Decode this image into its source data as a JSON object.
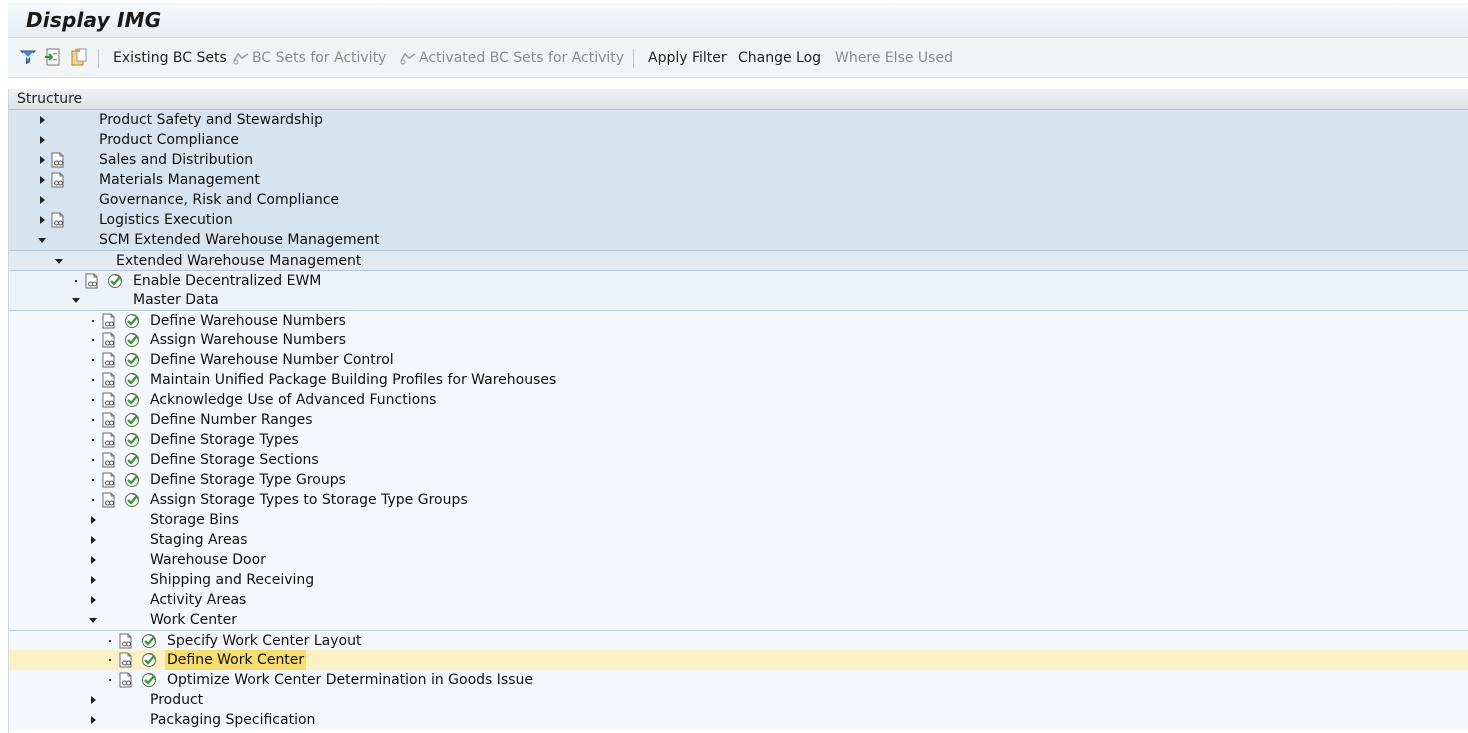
{
  "title": "Display IMG",
  "toolbar": {
    "icons": [
      "filter-icon",
      "export-icon",
      "clipboard-icon"
    ],
    "buttons": [
      {
        "label": "Existing BC Sets",
        "enabled": true
      },
      {
        "label": "BC Sets for Activity",
        "enabled": false
      },
      {
        "label": "Activated BC Sets for Activity",
        "enabled": false
      },
      {
        "label": "Apply Filter",
        "enabled": true
      },
      {
        "label": "Change Log",
        "enabled": true
      },
      {
        "label": "Where Else Used",
        "enabled": false
      }
    ]
  },
  "tree": {
    "header": "Structure",
    "rows": [
      {
        "label": "Product Safety and Stewardship",
        "level": 0,
        "node": "closed",
        "doc": false,
        "exec": false
      },
      {
        "label": "Product Compliance",
        "level": 0,
        "node": "closed",
        "doc": false,
        "exec": false
      },
      {
        "label": "Sales and Distribution",
        "level": 0,
        "node": "closed",
        "doc": true,
        "exec": false
      },
      {
        "label": "Materials Management",
        "level": 0,
        "node": "closed",
        "doc": true,
        "exec": false
      },
      {
        "label": "Governance, Risk and Compliance",
        "level": 0,
        "node": "closed",
        "doc": false,
        "exec": false
      },
      {
        "label": "Logistics Execution",
        "level": 0,
        "node": "closed",
        "doc": true,
        "exec": false
      },
      {
        "label": "SCM Extended Warehouse Management",
        "level": 0,
        "node": "open",
        "doc": false,
        "exec": false
      },
      {
        "label": "Extended Warehouse Management",
        "level": 1,
        "node": "open",
        "doc": false,
        "exec": false
      },
      {
        "label": "Enable Decentralized EWM",
        "level": 2,
        "node": "leaf",
        "doc": true,
        "exec": true
      },
      {
        "label": "Master Data",
        "level": 2,
        "node": "open",
        "doc": false,
        "exec": false
      },
      {
        "label": "Define Warehouse Numbers",
        "level": 3,
        "node": "leaf",
        "doc": true,
        "exec": true
      },
      {
        "label": "Assign Warehouse Numbers",
        "level": 3,
        "node": "leaf",
        "doc": true,
        "exec": true
      },
      {
        "label": "Define Warehouse Number Control",
        "level": 3,
        "node": "leaf",
        "doc": true,
        "exec": true
      },
      {
        "label": "Maintain Unified Package Building Profiles for Warehouses",
        "level": 3,
        "node": "leaf",
        "doc": true,
        "exec": true
      },
      {
        "label": "Acknowledge Use of Advanced Functions",
        "level": 3,
        "node": "leaf",
        "doc": true,
        "exec": true
      },
      {
        "label": "Define Number Ranges",
        "level": 3,
        "node": "leaf",
        "doc": true,
        "exec": true
      },
      {
        "label": "Define Storage Types",
        "level": 3,
        "node": "leaf",
        "doc": true,
        "exec": true
      },
      {
        "label": "Define Storage Sections",
        "level": 3,
        "node": "leaf",
        "doc": true,
        "exec": true
      },
      {
        "label": "Define Storage Type Groups",
        "level": 3,
        "node": "leaf",
        "doc": true,
        "exec": true
      },
      {
        "label": "Assign Storage Types to Storage Type Groups",
        "level": 3,
        "node": "leaf",
        "doc": true,
        "exec": true
      },
      {
        "label": "Storage Bins",
        "level": 3,
        "node": "closed",
        "doc": false,
        "exec": false
      },
      {
        "label": "Staging Areas",
        "level": 3,
        "node": "closed",
        "doc": false,
        "exec": false
      },
      {
        "label": "Warehouse Door",
        "level": 3,
        "node": "closed",
        "doc": false,
        "exec": false
      },
      {
        "label": "Shipping and Receiving",
        "level": 3,
        "node": "closed",
        "doc": false,
        "exec": false
      },
      {
        "label": "Activity Areas",
        "level": 3,
        "node": "closed",
        "doc": false,
        "exec": false
      },
      {
        "label": "Work Center",
        "level": 3,
        "node": "open",
        "doc": false,
        "exec": false
      },
      {
        "label": "Specify Work Center Layout",
        "level": 4,
        "node": "leaf",
        "doc": true,
        "exec": true
      },
      {
        "label": "Define Work Center",
        "level": 4,
        "node": "leaf",
        "doc": true,
        "exec": true,
        "selected": true
      },
      {
        "label": "Optimize Work Center Determination in Goods Issue",
        "level": 4,
        "node": "leaf",
        "doc": true,
        "exec": true
      },
      {
        "label": "Product",
        "level": 3,
        "node": "closed",
        "doc": false,
        "exec": false
      },
      {
        "label": "Packaging Specification",
        "level": 3,
        "node": "closed",
        "doc": false,
        "exec": false
      }
    ]
  },
  "colors": {
    "level0_bg": "#d7e3ef",
    "selected_bg": "#fcf1c4",
    "selected_label_bg": "#f7dc6f",
    "exec_icon": "#3a9a3a"
  }
}
